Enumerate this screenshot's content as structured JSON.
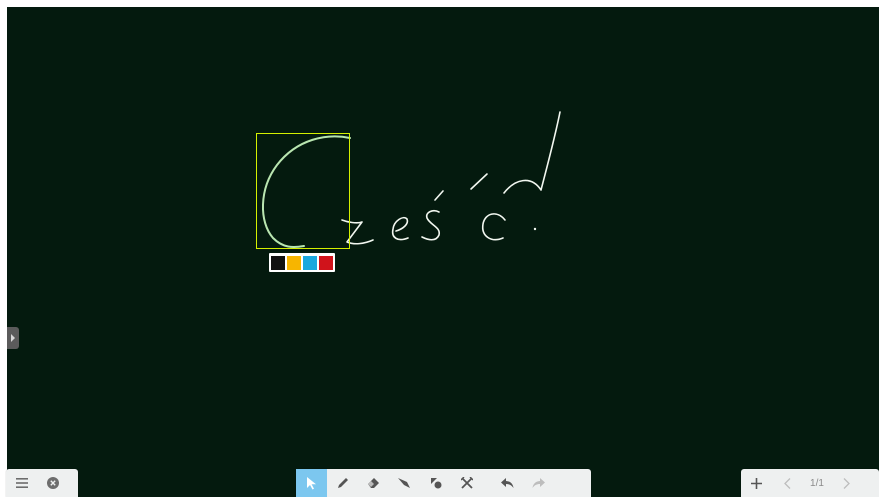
{
  "canvas": {
    "background_color": "#041a0e",
    "ink_color": "#f2f7f0",
    "selected_stroke_color": "#b9e6b0",
    "selection_color": "#e6ff2a"
  },
  "handwriting": {
    "text": "Cześć!"
  },
  "color_palette": [
    {
      "name": "black",
      "color": "#111111"
    },
    {
      "name": "yellow",
      "color": "#f7b500"
    },
    {
      "name": "blue",
      "color": "#1aa8de"
    },
    {
      "name": "red",
      "color": "#d0131b"
    }
  ],
  "toolbar_left": {
    "menu_icon": "hamburger-menu-icon",
    "close_icon": "close-circle-icon"
  },
  "toolbar_center": {
    "tools": [
      {
        "name": "select-tool",
        "icon": "cursor-arrow-icon",
        "active": true
      },
      {
        "name": "pen-tool",
        "icon": "pen-icon",
        "active": false
      },
      {
        "name": "eraser-tool",
        "icon": "eraser-icon",
        "active": false
      },
      {
        "name": "highlighter-tool",
        "icon": "highlighter-icon",
        "active": false
      },
      {
        "name": "shape-tool",
        "icon": "shapes-icon",
        "active": false
      },
      {
        "name": "clear-tool",
        "icon": "cross-tools-icon",
        "active": false
      }
    ],
    "undo_icon": "undo-icon",
    "redo_icon": "redo-icon"
  },
  "toolbar_right": {
    "add_page_icon": "plus-icon",
    "prev_page_icon": "chevron-left-icon",
    "next_page_icon": "chevron-right-icon",
    "page_indicator": "1/1"
  }
}
